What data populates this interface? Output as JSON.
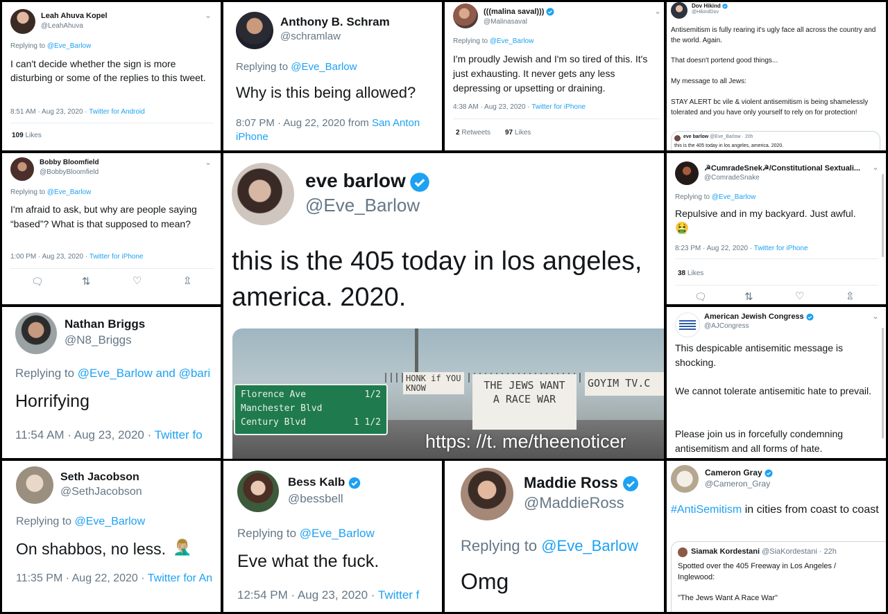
{
  "t1": {
    "name": "Leah Ahuva Kopel",
    "handle": "@LeahAhuva",
    "replying_prefix": "Replying to",
    "replying_to": "@Eve_Barlow",
    "text": "I can't decide whether the sign is more disturbing or some of the replies to this tweet.",
    "time": "8:51 AM · Aug 23, 2020 ·",
    "source": "Twitter for Android",
    "likes_count": "109",
    "likes_label": "Likes"
  },
  "t2": {
    "name": "Anthony B. Schram",
    "handle": "@schramlaw",
    "replying_prefix": "Replying to",
    "replying_to": "@Eve_Barlow",
    "text": "Why is this being allowed?",
    "time": "8:07 PM · Aug 22, 2020 from",
    "source_place": "San Anton",
    "source": "iPhone"
  },
  "t3": {
    "name": "(((malina saval)))",
    "handle": "@Malinasaval",
    "replying_prefix": "Replying to",
    "replying_to": "@Eve_Barlow",
    "text": "I'm proudly Jewish and I'm so tired of this. It's just exhausting. It never gets any less depressing or upsetting or draining.",
    "time": "4:38 AM · Aug 23, 2020 ·",
    "source": "Twitter for iPhone",
    "retweets_count": "2",
    "retweets_label": "Retweets",
    "likes_count": "97",
    "likes_label": "Likes"
  },
  "t4": {
    "name": "Dov Hikind",
    "handle": "@HikindDov",
    "p1": "Antisemitism is fully rearing it's ugly face all across the country and the world. Again.",
    "p2": "That doesn't portend good things...",
    "p3": "My message to all Jews:",
    "p4": "STAY ALERT bc vile & violent antisemitism is being shamelessly tolerated and you have only yourself to rely on for protection!",
    "quote_name": "eve barlow",
    "quote_handle": "@Eve_Barlow · 20h",
    "quote_text": "this is the 405 today in los angeles, america. 2020."
  },
  "t5": {
    "name": "Bobby Bloomfield",
    "handle": "@BobbyBloomfield",
    "replying_prefix": "Replying to",
    "replying_to": "@Eve_Barlow",
    "text": "I'm afraid to ask, but why are people saying “based”? What is that supposed to mean?",
    "time": "1:00 PM · Aug 23, 2020 ·",
    "source": "Twitter for iPhone"
  },
  "center": {
    "name": "eve barlow",
    "handle": "@Eve_Barlow",
    "text": "this is the 405 today in los angeles, america. 2020.",
    "sign_lines": [
      "Florence Ave",
      "Manchester Blvd",
      "Century Blvd"
    ],
    "sign_fracs": [
      "1/2",
      "",
      "1 1/2"
    ],
    "banner1": "HONK if YOU KNOW",
    "banner2": "THE JEWS WANT A RACE WAR",
    "banner3": "GOYIM TV.C",
    "watermark": "https: //t. me/theenoticer"
  },
  "t7": {
    "name": "☭CumradeSnek☭/Constitutional Sextuali...",
    "handle": "@ComradeSnake",
    "replying_prefix": "Replying to",
    "replying_to": "@Eve_Barlow",
    "text": "Repulsive and in my backyard. Just awful.",
    "emoji": "🤮",
    "time": "8:23 PM · Aug 22, 2020 ·",
    "source": "Twitter for iPhone",
    "likes_count": "38",
    "likes_label": "Likes"
  },
  "t8": {
    "name": "Nathan Briggs",
    "handle": "@N8_Briggs",
    "replying_prefix": "Replying to",
    "replying_to": "@Eve_Barlow and @bari",
    "text": "Horrifying",
    "time": "11:54 AM · Aug 23, 2020 ·",
    "source": "Twitter fo"
  },
  "t9": {
    "name": "American Jewish Congress",
    "handle": "@AJCongress",
    "p1": "This despicable antisemitic message is shocking.",
    "p2": "We cannot tolerate antisemitic hate to prevail.",
    "p3": "Please join us in forcefully condemning antisemitism and all forms of hate."
  },
  "t10": {
    "name": "Seth Jacobson",
    "handle": "@SethJacobson",
    "replying_prefix": "Replying to",
    "replying_to": "@Eve_Barlow",
    "text": "On shabbos, no less.",
    "emoji": "🤦🏼‍♂️",
    "time": "11:35 PM · Aug 22, 2020 ·",
    "source": "Twitter for An"
  },
  "t11": {
    "name": "Bess Kalb",
    "handle": "@bessbell",
    "replying_prefix": "Replying to",
    "replying_to": "@Eve_Barlow",
    "text": "Eve what the fuck.",
    "time": "12:54 PM · Aug 23, 2020 ·",
    "source": "Twitter f"
  },
  "t12": {
    "name": "Maddie Ross",
    "handle": "@MaddieRoss",
    "replying_prefix": "Replying to",
    "replying_to": "@Eve_Barlow",
    "text": "Omg"
  },
  "t13": {
    "name": "Cameron Gray",
    "handle": "@Cameron_Gray",
    "hashtag": "#AntiSemitism",
    "text": "in cities from coast to coast",
    "quote_name": "Siamak Kordestani",
    "quote_handle": "@SiaKordestani · 22h",
    "quote_text": "Spotted over the 405 Freeway in Los Angeles / Inglewood:",
    "quote_text2": "\"The Jews Want A Race War\""
  },
  "colors": {
    "link": "#1da1f2",
    "verified": "#1da1f2",
    "muted": "#657786"
  }
}
